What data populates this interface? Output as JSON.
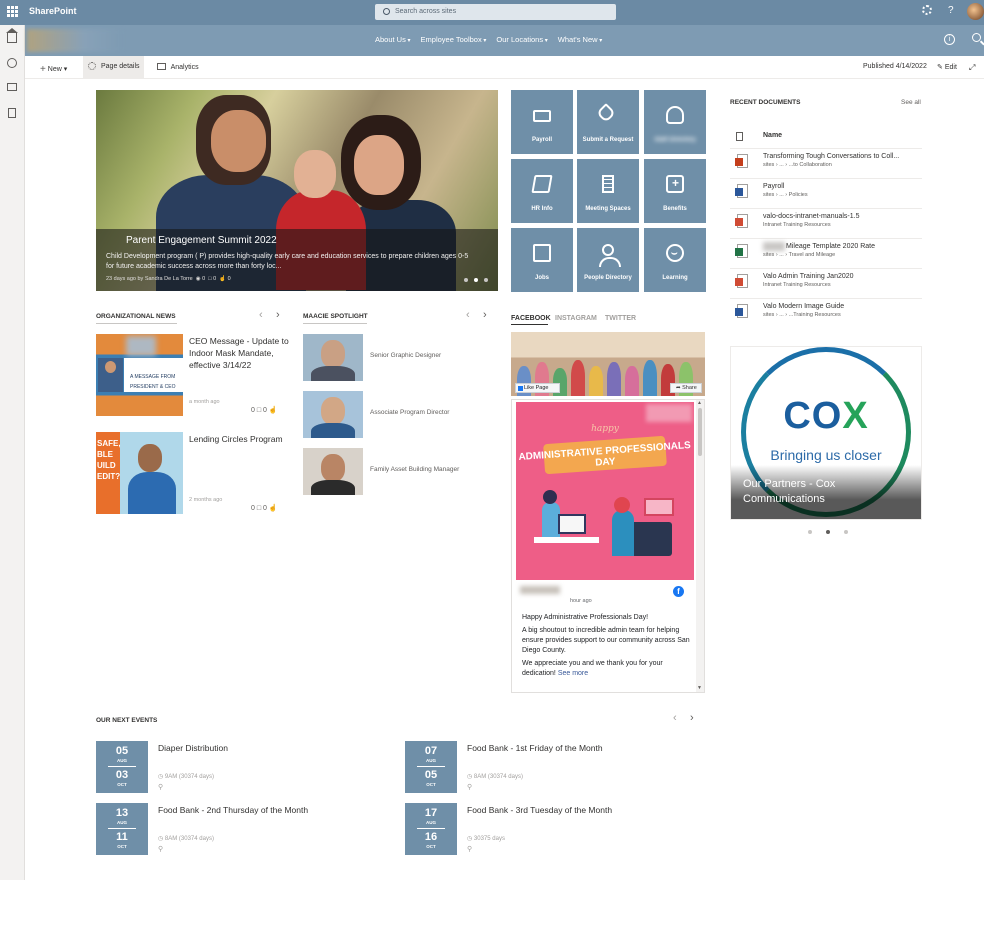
{
  "suite": {
    "app_name": "SharePoint",
    "search_placeholder": "Search across sites",
    "help": "?"
  },
  "site": {
    "nav": [
      "About Us",
      "Employee Toolbox",
      "Our Locations",
      "What's New"
    ],
    "info": "i"
  },
  "commandbar": {
    "new": "New",
    "page_details": "Page details",
    "analytics": "Analytics",
    "published": "Published 4/14/2022",
    "edit": "Edit"
  },
  "hero": {
    "title": "Parent Engagement Summit 2022",
    "text": "Child Development program ( P) provides high-quality early care and education services to prepare children ages 0-5 for future academic success across more than forty loc...",
    "meta": "23 days ago by Sandra De La Torre",
    "views": "0",
    "comments": "0",
    "likes": "0"
  },
  "tiles": [
    {
      "label": "Payroll",
      "icon": "money-icon"
    },
    {
      "label": "Submit a Request",
      "icon": "tag-icon"
    },
    {
      "label": "Staff Directory",
      "icon": "people-icon"
    },
    {
      "label": "HR Info",
      "icon": "book-icon"
    },
    {
      "label": "Meeting Spaces",
      "icon": "building-icon"
    },
    {
      "label": "Benefits",
      "icon": "medical-kit-icon"
    },
    {
      "label": "Jobs",
      "icon": "edit-icon"
    },
    {
      "label": "People Directory",
      "icon": "person-icon"
    },
    {
      "label": "Learning",
      "icon": "smile-icon"
    }
  ],
  "news": {
    "title": "ORGANIZATIONAL NEWS",
    "items": [
      {
        "title": "CEO Message - Update to Indoor Mask Mandate, effective 3/14/22",
        "image_text": "A MESSAGE FROM PRESIDENT & CEO",
        "meta": "a month ago",
        "comments": "0",
        "likes": "0"
      },
      {
        "title": "Lending Circles Program",
        "image_text": "SAFE, BLE UILD EDIT?",
        "meta": "2 months ago",
        "comments": "0",
        "likes": "0"
      }
    ]
  },
  "spotlight": {
    "title": "MAACIE SPOTLIGHT",
    "people": [
      {
        "role": "Senior Graphic Designer"
      },
      {
        "role": "Associate Program Director"
      },
      {
        "role": "Family Asset Building Manager"
      }
    ]
  },
  "social": {
    "tabs": [
      "FACEBOOK",
      "INSTAGRAM",
      "TWITTER"
    ],
    "like_page": "Like Page",
    "share": "Share",
    "post_time": "hour ago",
    "post_image": {
      "happy": "happy",
      "banner": "ADMINISTRATIVE PROFESSIONALS DAY"
    },
    "post_lines": [
      "Happy Administrative Professionals Day!",
      "A big shoutout to incredible admin team for helping ensure provides support to our community across San Diego County.",
      "We appreciate you and we thank you for your dedication!"
    ],
    "see_more": "See more",
    "brand": "f"
  },
  "documents": {
    "title": "RECENT DOCUMENTS",
    "see_all": "See all",
    "column": "Name",
    "items": [
      {
        "name": "Transforming Tough Conversations to Coll...",
        "path": "sites › ... › ...to Collaboration",
        "type": "ppt"
      },
      {
        "name": "Payroll",
        "path": "sites › ... › Policies",
        "type": "word"
      },
      {
        "name": "valo-docs-intranet-manuals-1.5",
        "path": "Intranet Training Resources",
        "type": "pdf"
      },
      {
        "name": "Mileage Template 2020 Rate",
        "path": "sites › ... › Travel and Mileage",
        "type": "xls"
      },
      {
        "name": "Valo Admin Training Jan2020",
        "path": "Intranet Training Resources",
        "type": "pdf"
      },
      {
        "name": "Valo Modern Image Guide",
        "path": "sites › ... › ...Training Resources",
        "type": "word"
      }
    ]
  },
  "partners": {
    "logo_c": "CO",
    "logo_x": "X",
    "tagline": "Bringing us closer",
    "caption": "Our Partners - Cox Communications"
  },
  "events": {
    "title": "OUR NEXT EVENTS",
    "items": [
      {
        "day1": "05",
        "mon1": "AUG",
        "day2": "03",
        "mon2": "OCT",
        "title": "Diaper Distribution",
        "time": "9AM (30374 days)"
      },
      {
        "day1": "07",
        "mon1": "AUG",
        "day2": "05",
        "mon2": "OCT",
        "title": "Food Bank - 1st Friday of the Month",
        "time": "8AM (30374 days)"
      },
      {
        "day1": "13",
        "mon1": "AUG",
        "day2": "11",
        "mon2": "OCT",
        "title": "Food Bank - 2nd Thursday of the Month",
        "time": "8AM (30374 days)"
      },
      {
        "day1": "17",
        "mon1": "AUG",
        "day2": "16",
        "mon2": "OCT",
        "title": "Food Bank - 3rd Tuesday of the Month",
        "time": "30375 days"
      }
    ]
  },
  "colors": {
    "suite_bar": "#6b8aa4",
    "site_bar": "#7e9bb3",
    "tile": "#6f8fa8",
    "facebook": "#1877f2"
  }
}
